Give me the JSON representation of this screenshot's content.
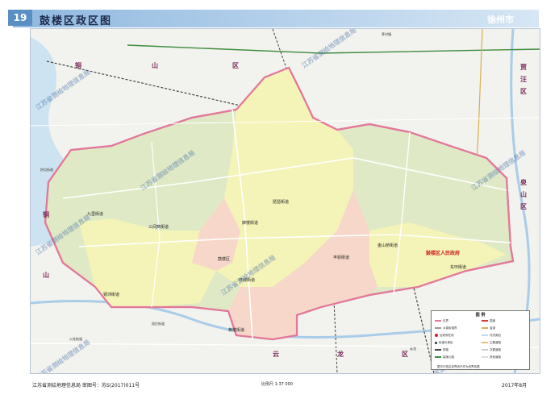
{
  "page": {
    "number": "19",
    "title": "鼓楼区政区图",
    "city": "徐州市"
  },
  "adjacent_regions": [
    {
      "text": "铜",
      "id": "tong1"
    },
    {
      "text": "山",
      "id": "shan1"
    },
    {
      "text": "区",
      "id": "qu1"
    },
    {
      "text": "贾",
      "id": "jia"
    },
    {
      "text": "汪",
      "id": "wang"
    },
    {
      "text": "区",
      "id": "qu2"
    },
    {
      "text": "泉",
      "id": "quan"
    },
    {
      "text": "山",
      "id": "shan2"
    },
    {
      "text": "区",
      "id": "qu3"
    },
    {
      "text": "云",
      "id": "yun"
    },
    {
      "text": "龙",
      "id": "long"
    },
    {
      "text": "区",
      "id": "qu4"
    },
    {
      "text": "铜",
      "id": "tong2"
    },
    {
      "text": "山",
      "id": "shan3"
    }
  ],
  "subdistricts": [
    {
      "name": "九里街道",
      "id": "jiuli"
    },
    {
      "name": "牌楼街道",
      "id": "pailou"
    },
    {
      "name": "丰财街道",
      "id": "fengcai"
    },
    {
      "name": "环城街道",
      "id": "huancheng"
    },
    {
      "name": "黄楼街道",
      "id": "huanglou"
    },
    {
      "name": "金山桥街道",
      "id": "jinshanqiao"
    },
    {
      "name": "东环街道",
      "id": "donghuan"
    },
    {
      "name": "琵琶街道",
      "id": "pipa"
    },
    {
      "name": "铜沛街道",
      "id": "tongpei"
    },
    {
      "name": "三间窝街道",
      "id": "sanjianwo"
    },
    {
      "name": "鼓楼区",
      "id": "gulou"
    }
  ],
  "outside_labels": [
    {
      "name": "茅村镇",
      "id": "maocun"
    },
    {
      "name": "拾屯街道",
      "id": "shitun"
    },
    {
      "name": "火花街道",
      "id": "huohua"
    },
    {
      "name": "段庄街道",
      "id": "duanzhuang"
    },
    {
      "name": "云龙",
      "id": "yunlong2"
    }
  ],
  "red_note": "鼓楼区人民政府",
  "watermark": "江苏省测绘地理信息局",
  "legend": {
    "title": "图   例",
    "items": [
      "区界",
      "乡镇街道界",
      "区政府驻地",
      "街道办事处",
      "铁路",
      "高速公路",
      "国道",
      "省道",
      "河流湖泊",
      "主要道路",
      "次要道路",
      "其他道路"
    ]
  },
  "footer": {
    "source": "江苏省测绘地理信息局    审图号：苏S(2017)011号",
    "scale": "比例尺  1:37 000",
    "date": "2017年8月",
    "note": "图中行政区划界线不作为划界依据"
  },
  "colors": {
    "yellow_zone": "#f4f3b8",
    "green_zone": "#dfe9c6",
    "pink_zone": "#f6d7c9",
    "boundary": "#e2789a",
    "water": "#bfd9ef",
    "road_main": "#d8b04d",
    "rail": "#444444"
  }
}
